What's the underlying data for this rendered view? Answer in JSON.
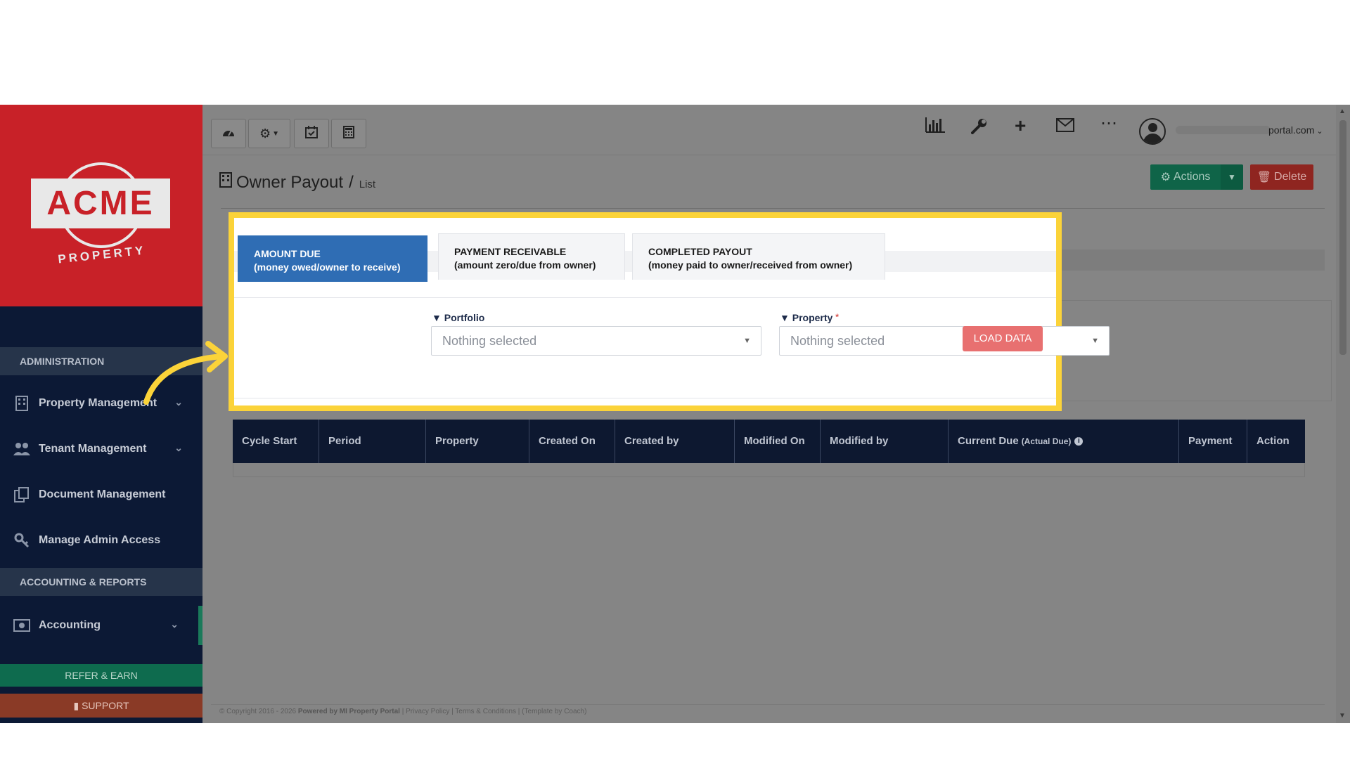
{
  "brand": {
    "logo_text": "ACME",
    "logo_sub": "PROPERTY"
  },
  "sidebar": {
    "sections": [
      "ADMINISTRATION",
      "ACCOUNTING & REPORTS"
    ],
    "items": [
      {
        "label": "Property Management",
        "icon": "building-icon"
      },
      {
        "label": "Tenant Management",
        "icon": "users-icon"
      },
      {
        "label": "Document Management",
        "icon": "documents-icon"
      },
      {
        "label": "Manage Admin Access",
        "icon": "key-icon"
      },
      {
        "label": "Accounting",
        "icon": "money-icon"
      }
    ],
    "refer_label": "REFER & EARN",
    "support_label": "SUPPORT"
  },
  "topbar": {
    "left_icons": [
      "dashboard-icon",
      "settings-icon",
      "calendar-icon",
      "calculator-icon"
    ],
    "right_icons": [
      "chart-icon",
      "wrench-icon",
      "plus-icon",
      "mail-icon",
      "more-icon"
    ],
    "user_email_visible": "portal.com"
  },
  "header": {
    "title": "Owner Payout",
    "separator": "/",
    "crumb": "List",
    "actions_label": "Actions",
    "delete_label": "Delete"
  },
  "tabs": [
    {
      "line1": "AMOUNT DUE",
      "line2": "(money owed/owner to receive)",
      "active": true
    },
    {
      "line1": "PAYMENT RECEIVABLE",
      "line2": "(amount zero/due from owner)",
      "active": false
    },
    {
      "line1": "COMPLETED PAYOUT",
      "line2": "(money paid to owner/received from owner)",
      "active": false
    }
  ],
  "filters": {
    "portfolio_label": "Portfolio",
    "portfolio_value": "Nothing selected",
    "property_label": "Property",
    "property_required": "*",
    "property_value": "Nothing selected",
    "load_label": "LOAD DATA"
  },
  "table": {
    "columns": [
      {
        "label": "Cycle Start"
      },
      {
        "label": "Period"
      },
      {
        "label": "Property"
      },
      {
        "label": "Created On"
      },
      {
        "label": "Created by"
      },
      {
        "label": "Modified On"
      },
      {
        "label": "Modified by"
      },
      {
        "label": "Current Due",
        "note": "(Actual Due)"
      },
      {
        "label": "Payment"
      },
      {
        "label": "Action"
      }
    ]
  },
  "footer": {
    "copyright": "© Copyright 2016 - 2026",
    "powered": "Powered by MI Property Portal",
    "links": "| Privacy Policy | Terms & Conditions |",
    "template": "(Template by Coach)"
  },
  "colors": {
    "brand_red": "#c82128",
    "sidebar_navy": "#0c1935",
    "highlight_yellow": "#fbd339",
    "tab_active_blue": "#2f6db4",
    "load_button": "#e87070"
  }
}
